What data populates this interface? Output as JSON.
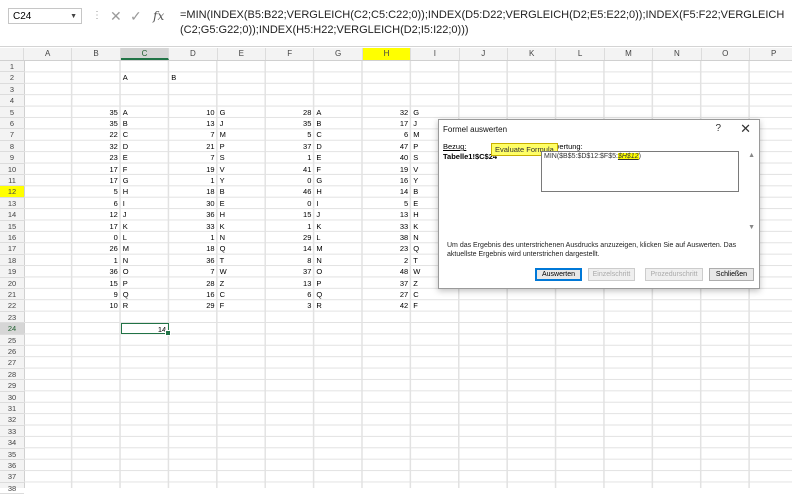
{
  "formula_bar": {
    "name_box": "C24",
    "cancel_icon": "✕",
    "enter_icon": "✓",
    "fx_label": "fx",
    "formula": "=MIN(INDEX(B5:B22;VERGLEICH(C2;C5:C22;0));INDEX(D5:D22;VERGLEICH(D2;E5:E22;0));INDEX(F5:F22;VERGLEICH(C2;G5:G22;0));INDEX(H5:H22;VERGLEICH(D2;I5:I22;0)))"
  },
  "columns": [
    "A",
    "B",
    "C",
    "D",
    "E",
    "F",
    "G",
    "H",
    "I",
    "J",
    "K",
    "L",
    "M",
    "N",
    "O",
    "P"
  ],
  "rows": [
    "1",
    "2",
    "3",
    "4",
    "5",
    "6",
    "7",
    "8",
    "9",
    "10",
    "11",
    "12",
    "13",
    "14",
    "15",
    "16",
    "17",
    "18",
    "19",
    "20",
    "21",
    "22",
    "23",
    "24",
    "25",
    "26",
    "27",
    "28",
    "29",
    "30",
    "31",
    "32",
    "33",
    "34",
    "35",
    "36",
    "37",
    "38"
  ],
  "cells": {
    "c2": "A",
    "d2": "B",
    "c24": "14",
    "data_rows": [
      [
        "35",
        "A",
        "10",
        "G",
        "28",
        "A",
        "32",
        "G"
      ],
      [
        "35",
        "B",
        "13",
        "J",
        "35",
        "B",
        "17",
        "J"
      ],
      [
        "22",
        "C",
        "7",
        "M",
        "5",
        "C",
        "6",
        "M"
      ],
      [
        "32",
        "D",
        "21",
        "P",
        "37",
        "D",
        "47",
        "P"
      ],
      [
        "23",
        "E",
        "7",
        "S",
        "1",
        "E",
        "40",
        "S"
      ],
      [
        "17",
        "F",
        "19",
        "V",
        "41",
        "F",
        "19",
        "V"
      ],
      [
        "17",
        "G",
        "1",
        "Y",
        "0",
        "G",
        "16",
        "Y"
      ],
      [
        "5",
        "H",
        "18",
        "B",
        "46",
        "H",
        "14",
        "B"
      ],
      [
        "6",
        "I",
        "30",
        "E",
        "0",
        "I",
        "5",
        "E"
      ],
      [
        "12",
        "J",
        "36",
        "H",
        "15",
        "J",
        "13",
        "H"
      ],
      [
        "17",
        "K",
        "33",
        "K",
        "1",
        "K",
        "33",
        "K"
      ],
      [
        "0",
        "L",
        "1",
        "N",
        "29",
        "L",
        "38",
        "N"
      ],
      [
        "26",
        "M",
        "18",
        "Q",
        "14",
        "M",
        "23",
        "Q"
      ],
      [
        "1",
        "N",
        "36",
        "T",
        "8",
        "N",
        "2",
        "T"
      ],
      [
        "36",
        "O",
        "7",
        "W",
        "37",
        "O",
        "48",
        "W"
      ],
      [
        "15",
        "P",
        "28",
        "Z",
        "13",
        "P",
        "37",
        "Z"
      ],
      [
        "9",
        "Q",
        "16",
        "C",
        "6",
        "Q",
        "27",
        "C"
      ],
      [
        "10",
        "R",
        "29",
        "F",
        "3",
        "R",
        "42",
        "F"
      ]
    ]
  },
  "dialog": {
    "title": "Formel auswerten",
    "help": "?",
    "close": "✕",
    "ref_label": "Bezug:",
    "ref_value": "Tabelle1!$C$24",
    "eval_label": "Auswertung:",
    "tooltip": "Evaluate Formula",
    "eval_text_prefix": "MIN($B$5:$D$12:$F$5:",
    "eval_text_highlight": "$H$12",
    "eval_text_suffix": ")",
    "description": "Um das Ergebnis des unterstrichenen Ausdrucks anzuzeigen, klicken Sie auf Auswerten. Das aktuellste Ergebnis wird unterstrichen dargestellt.",
    "btn_auswerten": "Auswerten",
    "btn_einzelschritt": "Einzelschritt",
    "btn_prozedur": "Prozedurschritt",
    "btn_schliessen": "Schließen"
  },
  "colors": {
    "accent": "#217346",
    "highlight": "#ffff00"
  }
}
